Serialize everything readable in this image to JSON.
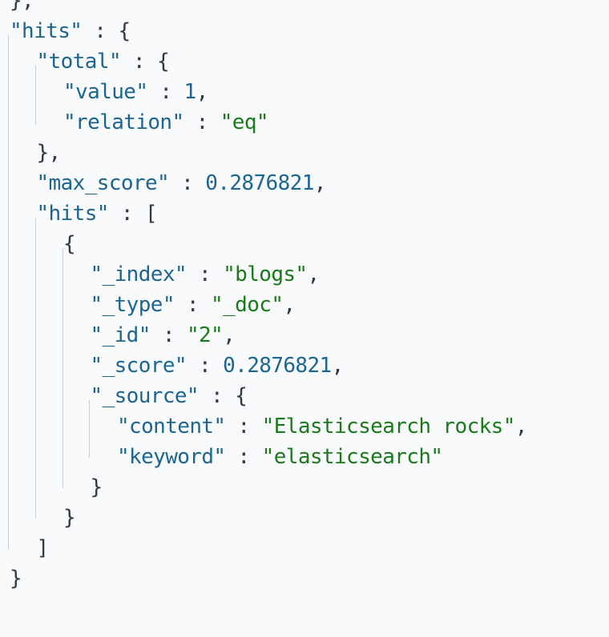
{
  "json_viewer": {
    "lines": [
      {
        "tokens": [
          {
            "t": "punc",
            "v": "},"
          }
        ]
      },
      {
        "tokens": [
          {
            "t": "key",
            "v": "\"hits\""
          },
          {
            "t": "punc",
            "v": " : {"
          }
        ]
      },
      {
        "tokens": [
          {
            "t": "key",
            "v": "\"total\""
          },
          {
            "t": "punc",
            "v": " : {"
          }
        ]
      },
      {
        "tokens": [
          {
            "t": "key",
            "v": "\"value\""
          },
          {
            "t": "punc",
            "v": " : "
          },
          {
            "t": "num",
            "v": "1"
          },
          {
            "t": "punc",
            "v": ","
          }
        ]
      },
      {
        "tokens": [
          {
            "t": "key",
            "v": "\"relation\""
          },
          {
            "t": "punc",
            "v": " : "
          },
          {
            "t": "str",
            "v": "\"eq\""
          }
        ]
      },
      {
        "tokens": [
          {
            "t": "punc",
            "v": "},"
          }
        ]
      },
      {
        "tokens": [
          {
            "t": "key",
            "v": "\"max_score\""
          },
          {
            "t": "punc",
            "v": " : "
          },
          {
            "t": "num",
            "v": "0.2876821"
          },
          {
            "t": "punc",
            "v": ","
          }
        ]
      },
      {
        "tokens": [
          {
            "t": "key",
            "v": "\"hits\""
          },
          {
            "t": "punc",
            "v": " : ["
          }
        ]
      },
      {
        "tokens": [
          {
            "t": "punc",
            "v": "{"
          }
        ]
      },
      {
        "tokens": [
          {
            "t": "key",
            "v": "\"_index\""
          },
          {
            "t": "punc",
            "v": " : "
          },
          {
            "t": "str",
            "v": "\"blogs\""
          },
          {
            "t": "punc",
            "v": ","
          }
        ]
      },
      {
        "tokens": [
          {
            "t": "key",
            "v": "\"_type\""
          },
          {
            "t": "punc",
            "v": " : "
          },
          {
            "t": "str",
            "v": "\"_doc\""
          },
          {
            "t": "punc",
            "v": ","
          }
        ]
      },
      {
        "tokens": [
          {
            "t": "key",
            "v": "\"_id\""
          },
          {
            "t": "punc",
            "v": " : "
          },
          {
            "t": "str",
            "v": "\"2\""
          },
          {
            "t": "punc",
            "v": ","
          }
        ]
      },
      {
        "tokens": [
          {
            "t": "key",
            "v": "\"_score\""
          },
          {
            "t": "punc",
            "v": " : "
          },
          {
            "t": "num",
            "v": "0.2876821"
          },
          {
            "t": "punc",
            "v": ","
          }
        ]
      },
      {
        "tokens": [
          {
            "t": "key",
            "v": "\"_source\""
          },
          {
            "t": "punc",
            "v": " : {"
          }
        ]
      },
      {
        "tokens": [
          {
            "t": "key",
            "v": "\"content\""
          },
          {
            "t": "punc",
            "v": " : "
          },
          {
            "t": "str",
            "v": "\"Elasticsearch rocks\""
          },
          {
            "t": "punc",
            "v": ","
          }
        ]
      },
      {
        "tokens": [
          {
            "t": "key",
            "v": "\"keyword\""
          },
          {
            "t": "punc",
            "v": " : "
          },
          {
            "t": "str",
            "v": "\"elasticsearch\""
          }
        ]
      },
      {
        "tokens": [
          {
            "t": "punc",
            "v": "}"
          }
        ]
      },
      {
        "tokens": [
          {
            "t": "punc",
            "v": "}"
          }
        ]
      },
      {
        "tokens": [
          {
            "t": "punc",
            "v": "]"
          }
        ]
      },
      {
        "tokens": [
          {
            "t": "punc",
            "v": "}"
          }
        ]
      }
    ]
  },
  "colors": {
    "background": "#f9fafc",
    "key": "#1c6591",
    "string": "#1a7a1a",
    "number": "#1c6591",
    "punctuation": "#343741",
    "indent_guide": "#c8ccd4"
  }
}
